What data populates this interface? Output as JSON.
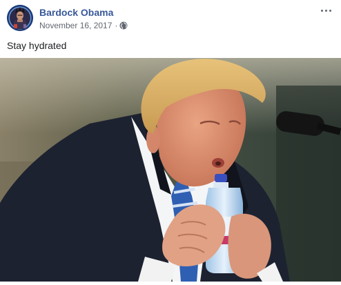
{
  "post": {
    "author_name": "Bardock Obama",
    "date": "November 16, 2017",
    "separator": "·",
    "privacy_icon": "globe-icon",
    "more_icon": "more-options-icon",
    "caption": "Stay hydrated",
    "image_icon": "photo-image"
  },
  "colors": {
    "author_link": "#385898",
    "meta_text": "#616770",
    "body_text": "#1c1e21",
    "background": "#ffffff"
  }
}
